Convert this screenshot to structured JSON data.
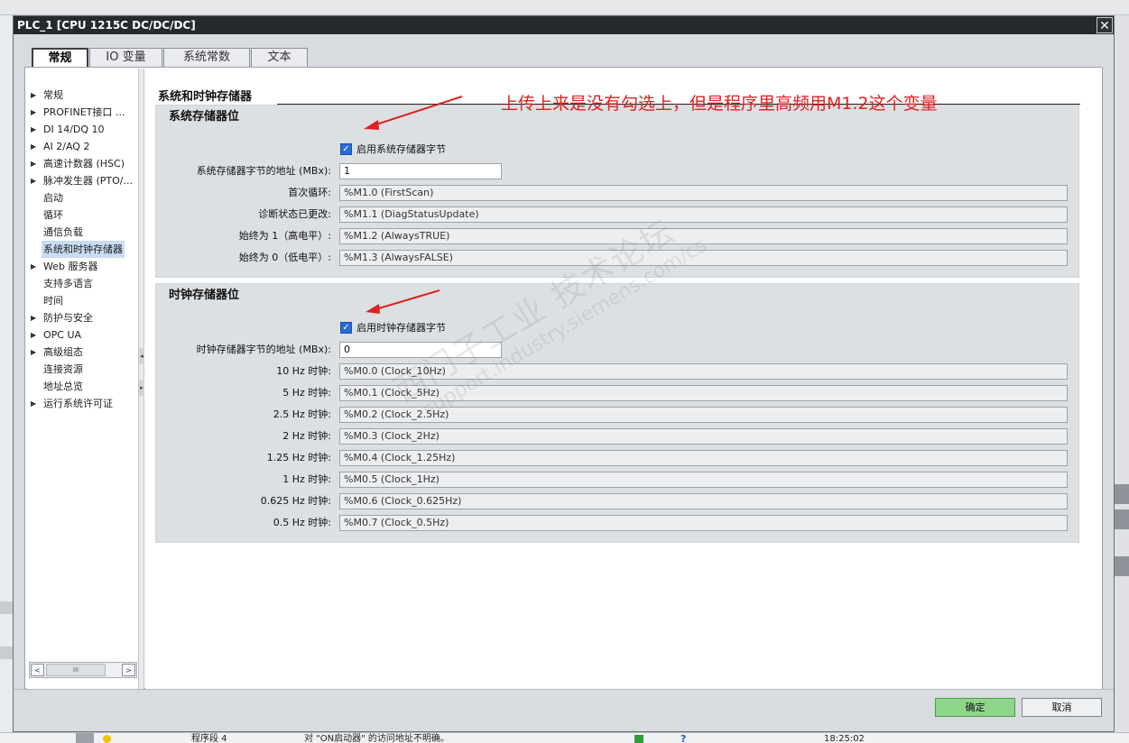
{
  "window": {
    "title": "PLC_1 [CPU 1215C DC/DC/DC]",
    "close_glyph": "✕"
  },
  "tabs": [
    {
      "label": "常规",
      "active": true
    },
    {
      "label": "IO 变量",
      "active": false
    },
    {
      "label": "系统常数",
      "active": false
    },
    {
      "label": "文本",
      "active": false
    }
  ],
  "nav": {
    "items": [
      {
        "label": "常规",
        "expandable": true
      },
      {
        "label": "PROFINET接口 ...",
        "expandable": true
      },
      {
        "label": "DI 14/DQ 10",
        "expandable": true
      },
      {
        "label": "AI 2/AQ 2",
        "expandable": true
      },
      {
        "label": "高速计数器 (HSC)",
        "expandable": true
      },
      {
        "label": "脉冲发生器 (PTO/...",
        "expandable": true
      },
      {
        "label": "启动",
        "expandable": false
      },
      {
        "label": "循环",
        "expandable": false
      },
      {
        "label": "通信负载",
        "expandable": false
      },
      {
        "label": "系统和时钟存储器",
        "expandable": false,
        "selected": true
      },
      {
        "label": "Web 服务器",
        "expandable": true
      },
      {
        "label": "支持多语言",
        "expandable": false
      },
      {
        "label": "时间",
        "expandable": false
      },
      {
        "label": "防护与安全",
        "expandable": true
      },
      {
        "label": "OPC UA",
        "expandable": true
      },
      {
        "label": "高级组态",
        "expandable": true
      },
      {
        "label": "连接资源",
        "expandable": false
      },
      {
        "label": "地址总览",
        "expandable": false
      },
      {
        "label": "运行系统许可证",
        "expandable": true
      }
    ],
    "scroll_left": "<",
    "scroll_right": ">",
    "scroll_grip": "III",
    "splitter_left": "◂",
    "splitter_right": "▸"
  },
  "panel": {
    "section_title": "系统和时钟存储器",
    "system_group": {
      "title": "系统存储器位",
      "checkbox_label": "启用系统存储器字节",
      "checked": true,
      "address_label": "系统存储器字节的地址 (MBx):",
      "address_value": "1",
      "rows": [
        {
          "label": "首次循环:",
          "value": "%M1.0 (FirstScan)"
        },
        {
          "label": "诊断状态已更改:",
          "value": "%M1.1 (DiagStatusUpdate)"
        },
        {
          "label": "始终为 1（高电平）:",
          "value": "%M1.2 (AlwaysTRUE)"
        },
        {
          "label": "始终为 0（低电平）:",
          "value": "%M1.3 (AlwaysFALSE)"
        }
      ]
    },
    "clock_group": {
      "title": "时钟存储器位",
      "checkbox_label": "启用时钟存储器字节",
      "checked": true,
      "address_label": "时钟存储器字节的地址 (MBx):",
      "address_value": "0",
      "rows": [
        {
          "label": "10 Hz 时钟:",
          "value": "%M0.0 (Clock_10Hz)"
        },
        {
          "label": "5 Hz 时钟:",
          "value": "%M0.1 (Clock_5Hz)"
        },
        {
          "label": "2.5 Hz 时钟:",
          "value": "%M0.2 (Clock_2.5Hz)"
        },
        {
          "label": "2 Hz 时钟:",
          "value": "%M0.3 (Clock_2Hz)"
        },
        {
          "label": "1.25 Hz 时钟:",
          "value": "%M0.4 (Clock_1.25Hz)"
        },
        {
          "label": "1 Hz 时钟:",
          "value": "%M0.5 (Clock_1Hz)"
        },
        {
          "label": "0.625 Hz 时钟:",
          "value": "%M0.6 (Clock_0.625Hz)"
        },
        {
          "label": "0.5 Hz 时钟:",
          "value": "%M0.7 (Clock_0.5Hz)"
        }
      ]
    }
  },
  "annotation": {
    "text": "上传上来是没有勾选上，但是程序里高频用M1.2这个变量",
    "color": "#e02020"
  },
  "watermark": {
    "line1": "西门子工业  技术论坛",
    "line2": "support.industry.siemens.com/cs"
  },
  "footer": {
    "ok_label": "确定",
    "cancel_label": "取消"
  },
  "background_status": {
    "segment": "程序段 4",
    "message": "对 \"ON启动器\" 的访问地址不明确。",
    "time": "18:25:02"
  },
  "colors": {
    "accent": "#2a6ad6",
    "ok_button": "#8ed68a",
    "titlebar": "#26292e"
  }
}
